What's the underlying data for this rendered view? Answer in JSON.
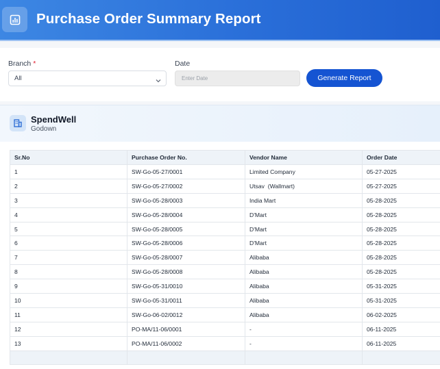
{
  "header": {
    "title": "Purchase Order Summary Report",
    "icon": "bar-chart-icon"
  },
  "filters": {
    "branch_label": "Branch",
    "branch_required_mark": "*",
    "branch_value": "All",
    "date_label": "Date",
    "date_placeholder": "Enter Date",
    "generate_label": "Generate Report"
  },
  "branch_card": {
    "name": "SpendWell",
    "subtitle": "Godown",
    "icon": "building-icon"
  },
  "table": {
    "columns": [
      "Sr.No",
      "Purchase Order No.",
      "Vendor Name",
      "Order Date"
    ],
    "rows": [
      [
        "1",
        "SW-Go-05-27/0001",
        "Limited Company",
        "05-27-2025"
      ],
      [
        "2",
        "SW-Go-05-27/0002",
        "Utsav  (Wallmart)",
        "05-27-2025"
      ],
      [
        "3",
        "SW-Go-05-28/0003",
        "India Mart",
        "05-28-2025"
      ],
      [
        "4",
        "SW-Go-05-28/0004",
        "D'Mart",
        "05-28-2025"
      ],
      [
        "5",
        "SW-Go-05-28/0005",
        "D'Mart",
        "05-28-2025"
      ],
      [
        "6",
        "SW-Go-05-28/0006",
        "D'Mart",
        "05-28-2025"
      ],
      [
        "7",
        "SW-Go-05-28/0007",
        "Alibaba",
        "05-28-2025"
      ],
      [
        "8",
        "SW-Go-05-28/0008",
        "Alibaba",
        "05-28-2025"
      ],
      [
        "9",
        "SW-Go-05-31/0010",
        "Alibaba",
        "05-31-2025"
      ],
      [
        "10",
        "SW-Go-05-31/0011",
        "Alibaba",
        "05-31-2025"
      ],
      [
        "11",
        "SW-Go-06-02/0012",
        "Alibaba",
        "06-02-2025"
      ],
      [
        "12",
        "PO-MA/11-06/0001",
        "-",
        "06-11-2025"
      ],
      [
        "13",
        "PO-MA/11-06/0002",
        "-",
        "06-11-2025"
      ]
    ]
  },
  "colors": {
    "accent": "#1554d2",
    "header_start": "#3d87e3",
    "header_end": "#1f5fcf",
    "required": "#e11d2e"
  }
}
